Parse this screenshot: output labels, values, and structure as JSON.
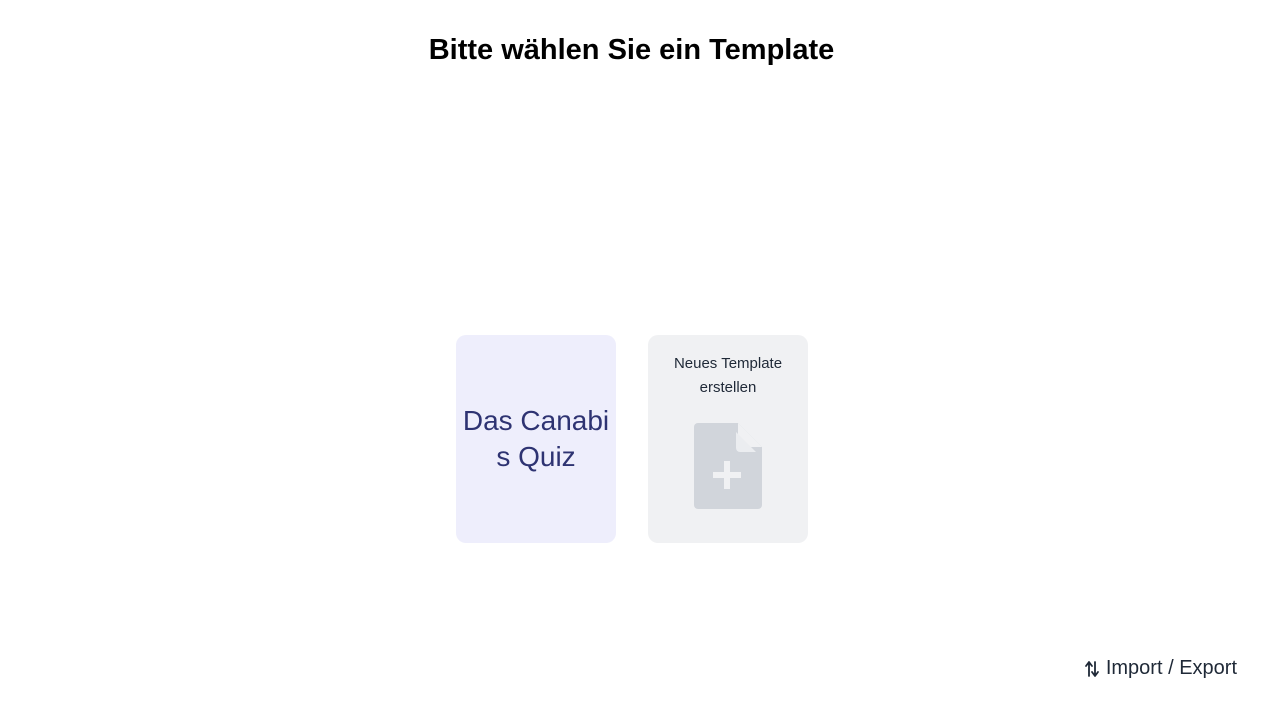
{
  "header": {
    "title": "Bitte wählen Sie ein Template"
  },
  "templates": [
    {
      "title": "Das Canabis Quiz"
    }
  ],
  "new_template": {
    "label": "Neues Template erstellen",
    "icon": "file-plus-icon"
  },
  "footer": {
    "import_export_label": "Import / Export",
    "icon": "swap-vertical-icon"
  },
  "colors": {
    "template_card_bg": "#eeeefc",
    "template_card_text": "#2e3372",
    "new_card_bg": "#f0f1f3",
    "file_icon": "#d1d5db"
  }
}
